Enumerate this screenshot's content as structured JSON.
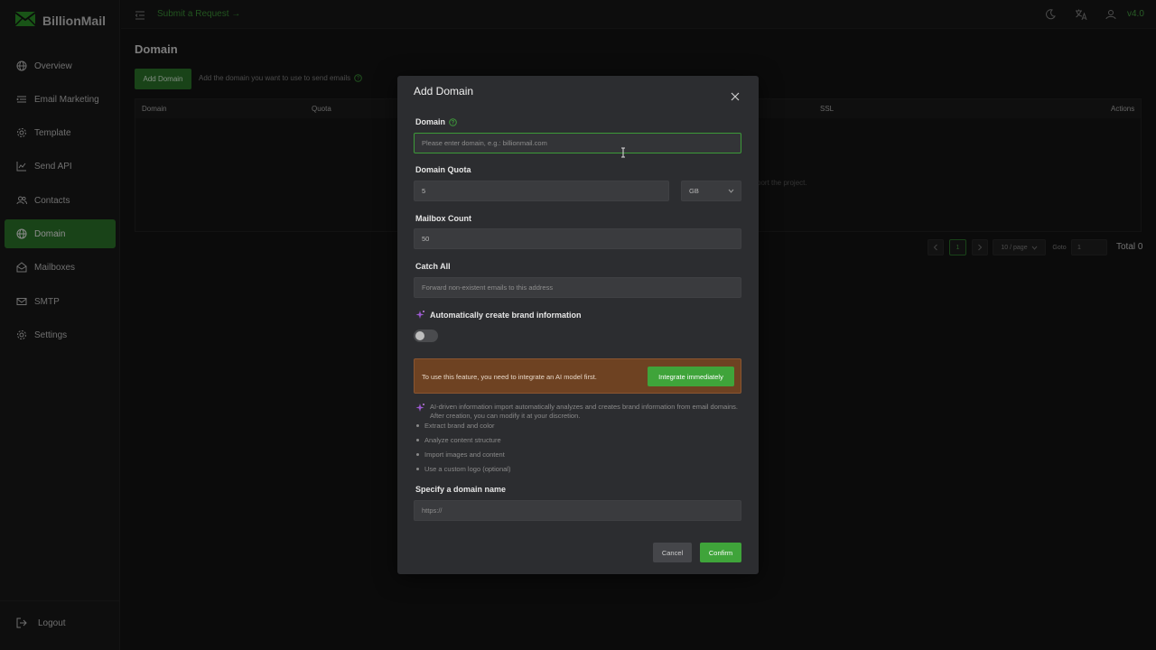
{
  "app": {
    "name": "BillionMail",
    "version": "v4.0"
  },
  "header": {
    "submit_request": "Submit a Request →"
  },
  "sidebar": {
    "items": [
      {
        "label": "Overview",
        "icon": "globe-icon"
      },
      {
        "label": "Email Marketing",
        "icon": "list-icon"
      },
      {
        "label": "Template",
        "icon": "gear-icon"
      },
      {
        "label": "Send API",
        "icon": "chart-line-icon"
      },
      {
        "label": "Contacts",
        "icon": "users-icon"
      },
      {
        "label": "Domain",
        "icon": "globe-icon",
        "active": true
      },
      {
        "label": "Mailboxes",
        "icon": "mailbox-icon"
      },
      {
        "label": "SMTP",
        "icon": "mail-icon"
      },
      {
        "label": "Settings",
        "icon": "gear-icon"
      }
    ],
    "logout": "Logout"
  },
  "page": {
    "title": "Domain",
    "add_button": "Add Domain",
    "add_hint": "Add the domain you want to use to send emails",
    "table": {
      "columns": [
        "Domain",
        "Quota",
        "SSL",
        "Actions"
      ],
      "empty_text": "port the project."
    },
    "pagination": {
      "current_page": "1",
      "page_size": "10 / page",
      "goto_label": "Goto",
      "goto_value": "1",
      "total": "Total 0"
    }
  },
  "modal": {
    "title": "Add Domain",
    "domain": {
      "label": "Domain",
      "placeholder": "Please enter domain, e.g.: billionmail.com",
      "value": ""
    },
    "quota": {
      "label": "Domain Quota",
      "value": "5",
      "unit": "GB"
    },
    "mailbox": {
      "label": "Mailbox Count",
      "value": "50"
    },
    "catch_all": {
      "label": "Catch All",
      "placeholder": "Forward non-existent emails to this address"
    },
    "ai": {
      "label": "Automatically create brand information",
      "enabled": false
    },
    "warning": {
      "text": "To use this feature, you need to integrate an AI model first.",
      "button": "Integrate immediately"
    },
    "description": "AI-driven information import automatically analyzes and creates brand information from email domains. After creation, you can modify it at your discretion.",
    "features": [
      "Extract brand and color",
      "Analyze content structure",
      "Import images and content",
      "Use a custom logo (optional)"
    ],
    "specify": {
      "label": "Specify a domain name",
      "placeholder": "https://"
    },
    "cancel": "Cancel",
    "confirm": "Confirm"
  },
  "colors": {
    "accent": "#3fa43a",
    "sidebar_active": "#2f7a2c",
    "warning_bg": "#6e4222"
  }
}
